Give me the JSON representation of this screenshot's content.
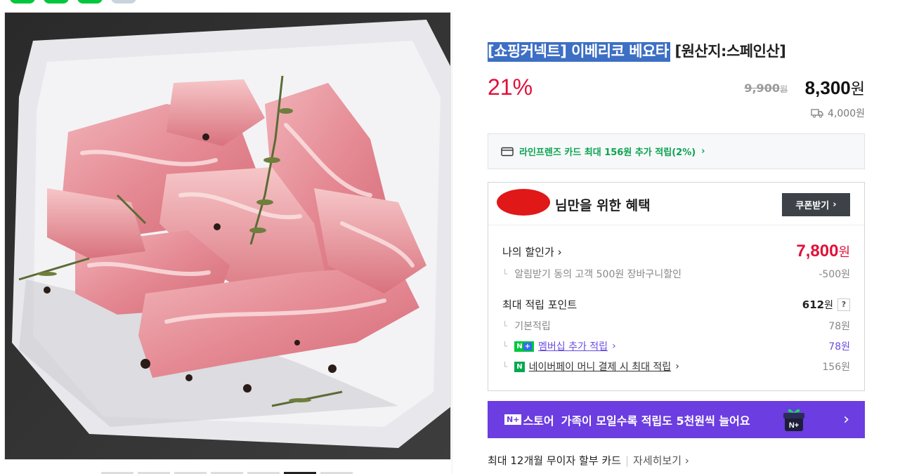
{
  "product": {
    "title_selected": "[쇼핑커넥트] 이베리코 베요타",
    "title_rest": " [원산지:스페인산]",
    "discount_rate": "21%",
    "original_price": "9,900",
    "original_unit": "원",
    "sale_price": "8,300",
    "sale_unit": "원",
    "shipping_fee": "4,000원",
    "image_alt": "sliced pork cuts on paper with rosemary and peppercorns"
  },
  "card_promo": {
    "text": "라인프렌즈 카드 최대 156원 추가 적립(2%)",
    "chevron": "›"
  },
  "benefit": {
    "title": "님만을 위한 혜택",
    "coupon_button": "쿠폰받기",
    "my_price_label": "나의 할인가",
    "my_price_value": "7,800",
    "my_price_unit": "원",
    "discount_detail_label": "알림받기 동의 고객 500원 장바구니할인",
    "discount_detail_value": "-500원",
    "max_points_label": "최대 적립 포인트",
    "max_points_value": "612",
    "max_points_unit": "원",
    "help": "?",
    "basic_label": "기본적립",
    "basic_value": "78원",
    "membership_label": "멤버십 추가 적립",
    "membership_value": "78원",
    "npay_label": "네이버페이 머니 결제 시 최대 적립",
    "npay_value": "156원"
  },
  "promo_banner": {
    "badge": "N+",
    "store_label": "스토어",
    "text": "가족이 모일수록 적립도 5천원씩 늘어요",
    "chevron": "›"
  },
  "installment": {
    "text": "최대 12개월 무이자 할부 카드",
    "more": "자세히보기"
  },
  "colors": {
    "accent_red": "#e0103a",
    "naver_green": "#00c73c",
    "promo_purple": "#6c3de0",
    "membership_purple": "#6a4de0"
  }
}
